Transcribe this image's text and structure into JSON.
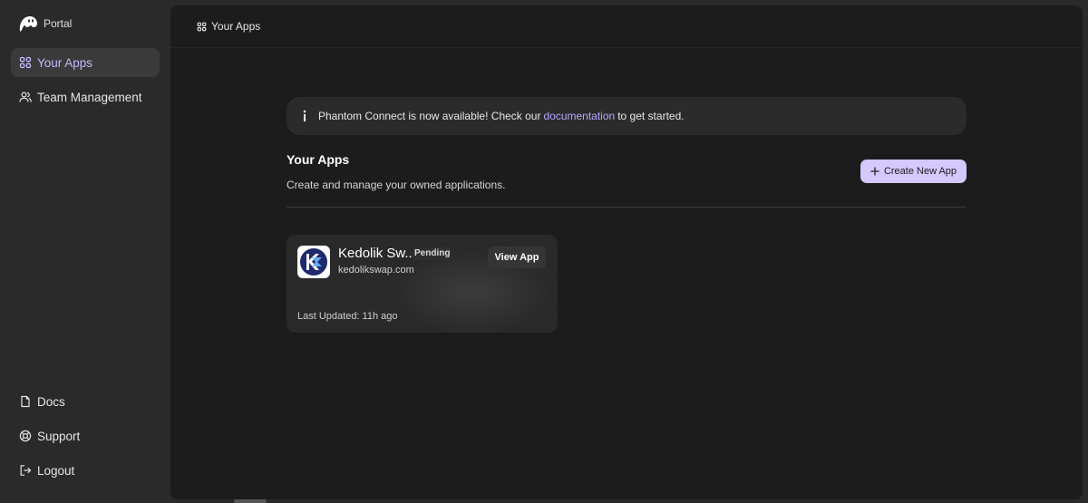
{
  "brand": {
    "name": "Portal",
    "icon": "phantom-ghost-icon"
  },
  "sidebar": {
    "nav": [
      {
        "label": "Your Apps",
        "icon": "apps-grid-icon",
        "active": true
      },
      {
        "label": "Team Management",
        "icon": "users-icon",
        "active": false
      }
    ],
    "footer": [
      {
        "label": "Docs",
        "icon": "document-icon"
      },
      {
        "label": "Support",
        "icon": "lifebuoy-icon"
      },
      {
        "label": "Logout",
        "icon": "logout-icon"
      }
    ]
  },
  "topbar": {
    "title": "Your Apps",
    "icon": "apps-grid-icon"
  },
  "banner": {
    "icon": "info-icon",
    "text_before": "Phantom Connect is now available! Check our",
    "link_text": "documentation",
    "text_after": "to get started."
  },
  "section": {
    "title": "Your Apps",
    "subtitle": "Create and manage your owned applications.",
    "create_button": "Create New App"
  },
  "apps": [
    {
      "name": "Kedolik Sw...",
      "status": "Pending",
      "domain": "kedolikswap.com",
      "view_button": "View App",
      "updated": "Last Updated: 11h ago"
    }
  ],
  "colors": {
    "accent": "#c9b8ff",
    "button_bg": "#d4c8ff",
    "panel_bg": "#1c1c1c",
    "sidebar_bg": "#2a2a2a",
    "logo_navy": "#1f2a6b"
  }
}
